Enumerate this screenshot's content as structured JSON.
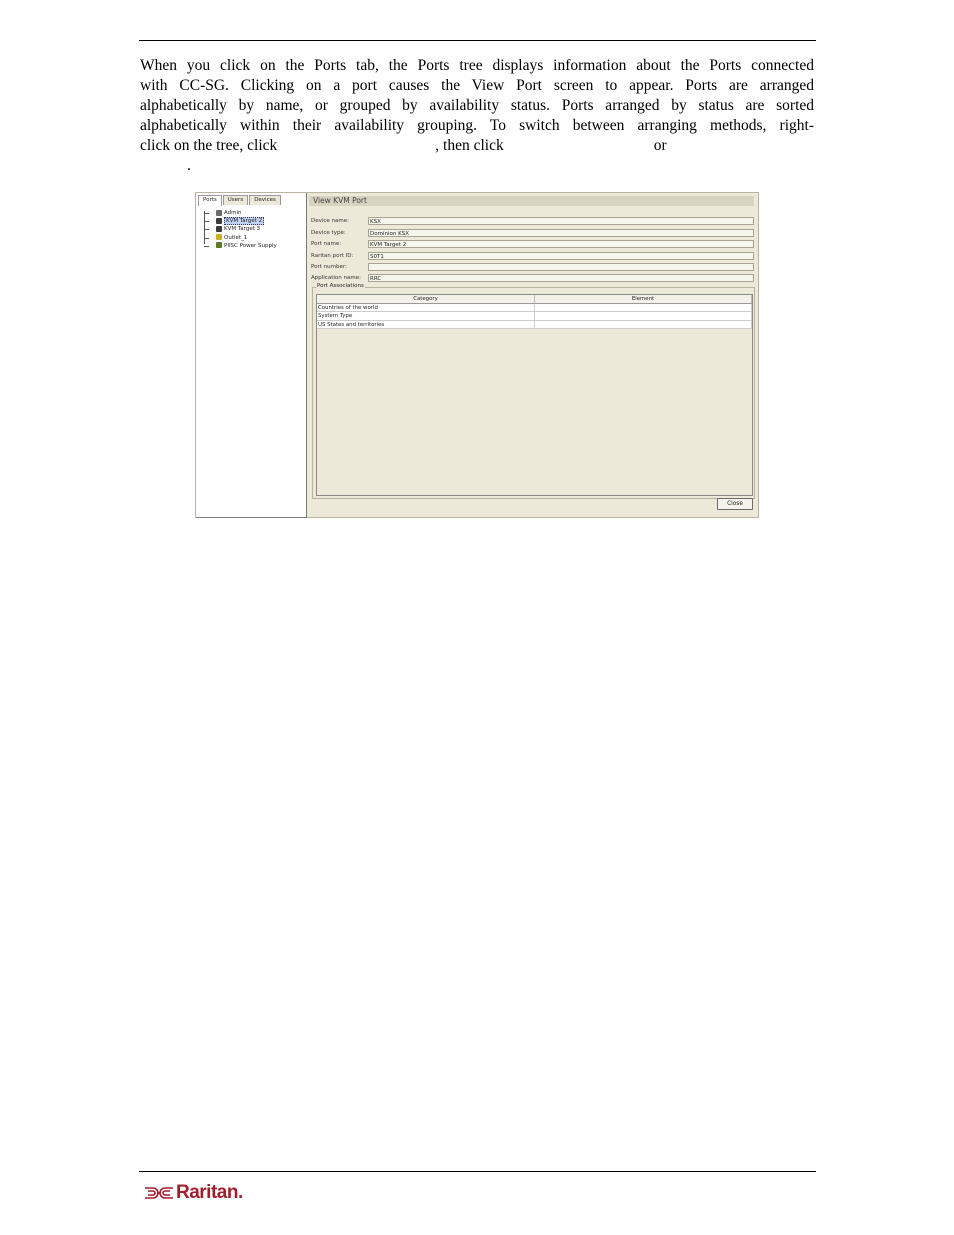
{
  "paragraph": {
    "line1": "When you click on the Ports tab, the Ports tree displays information about the Ports connected",
    "line2": "with CC-SG. Clicking on a port causes the View Port screen to appear. Ports are arranged",
    "line3": "alphabetically by name, or grouped by availability status. Ports arranged by status are sorted",
    "line4": "alphabetically within their availability grouping. To switch between arranging methods, right-",
    "line5_a": "click on the tree, click",
    "line5_b": ", then click",
    "line5_c": "or",
    "line6": "."
  },
  "screenshot": {
    "tabs": [
      "Ports",
      "Users",
      "Devices"
    ],
    "tree": [
      {
        "label": "Admin",
        "color": "#6a6a6a"
      },
      {
        "label": "KVM Target 2",
        "color": "#3a3a3a",
        "selected": true
      },
      {
        "label": "KVM Target 3",
        "color": "#3a3a3a"
      },
      {
        "label": "Outlet_1",
        "color": "#c8b020"
      },
      {
        "label": "PIISC Power Supply",
        "color": "#5a7a2a"
      }
    ],
    "title": "View KVM Port",
    "fields": [
      {
        "label": "Device name:",
        "value": "KSX"
      },
      {
        "label": "Device type:",
        "value": "Dominion KSX"
      },
      {
        "label": "Port name:",
        "value": "KVM Target 2"
      },
      {
        "label": "Raritan port ID:",
        "value": "S0T1"
      },
      {
        "label": "Port number:",
        "value": ""
      },
      {
        "label": "Application name:",
        "value": "RRC"
      }
    ],
    "associations_label": "Port Associations",
    "table": {
      "headers": [
        "Category",
        "Element"
      ],
      "rows": [
        [
          "Countries of the world",
          ""
        ],
        [
          "System Type",
          ""
        ],
        [
          "US States and territories",
          ""
        ]
      ]
    },
    "close_label": "Close"
  },
  "footer": {
    "logo_text": "Raritan.",
    "brand_color": "#a31e2c"
  }
}
